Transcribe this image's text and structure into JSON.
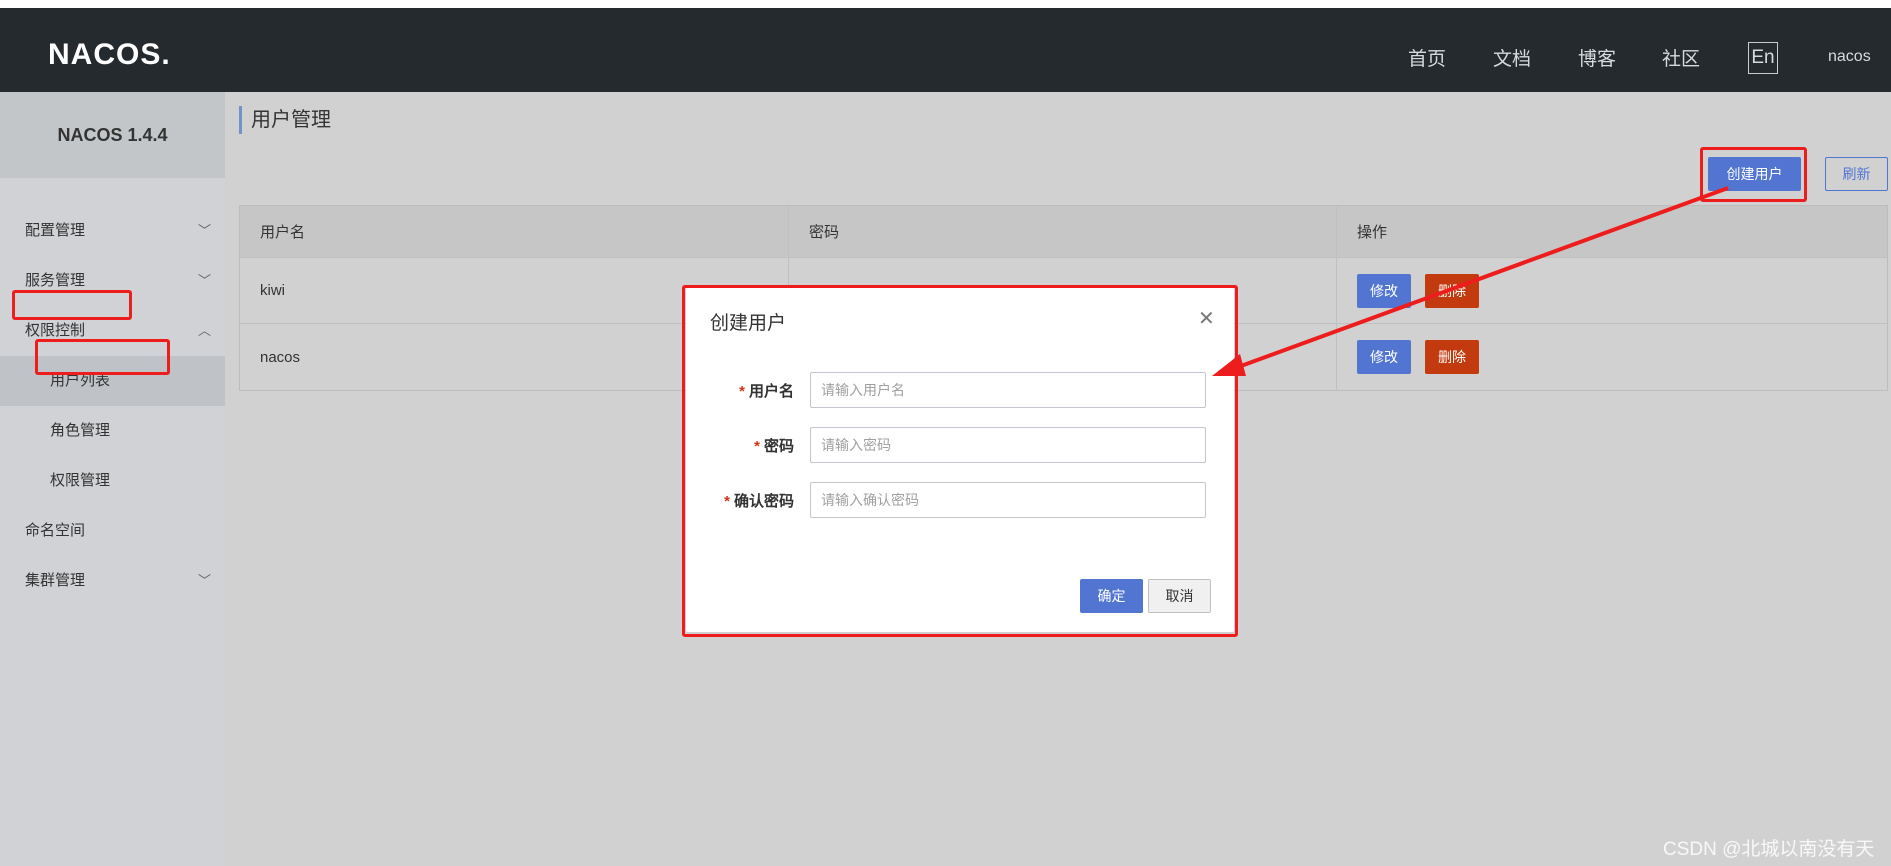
{
  "header": {
    "logo_text": "NACOS.",
    "nav": [
      "首页",
      "文档",
      "博客",
      "社区"
    ],
    "lang": "En",
    "user": "nacos"
  },
  "sidebar": {
    "version": "NACOS 1.4.4",
    "items": [
      {
        "label": "配置管理",
        "chevron": "chevron-down-icon"
      },
      {
        "label": "服务管理",
        "chevron": "chevron-down-icon"
      },
      {
        "label": "权限控制",
        "chevron": "chevron-up-icon"
      },
      {
        "label": "用户列表"
      },
      {
        "label": "角色管理"
      },
      {
        "label": "权限管理"
      },
      {
        "label": "命名空间"
      },
      {
        "label": "集群管理",
        "chevron": "chevron-down-icon"
      }
    ]
  },
  "main": {
    "title": "用户管理",
    "create_button": "创建用户",
    "refresh_button": "刷新",
    "table": {
      "headers": [
        "用户名",
        "密码",
        "操作"
      ],
      "rows": [
        {
          "username": "kiwi",
          "password": "************************************************************",
          "edit": "修改",
          "delete": "删除"
        },
        {
          "username": "nacos",
          "password": "************************************************************",
          "edit": "修改",
          "delete": "删除"
        }
      ]
    }
  },
  "dialog": {
    "title": "创建用户",
    "close_icon": "close-icon",
    "fields": [
      {
        "label": "用户名",
        "required": "*",
        "placeholder": "请输入用户名"
      },
      {
        "label": "密码",
        "required": "*",
        "placeholder": "请输入密码"
      },
      {
        "label": "确认密码",
        "required": "*",
        "placeholder": "请输入确认密码"
      }
    ],
    "ok": "确定",
    "cancel": "取消"
  },
  "annotation_color": "#ee1d1d",
  "accent_color": "#5275d2",
  "danger_color": "#c43a0f",
  "watermark": "CSDN @北城以南没有天"
}
